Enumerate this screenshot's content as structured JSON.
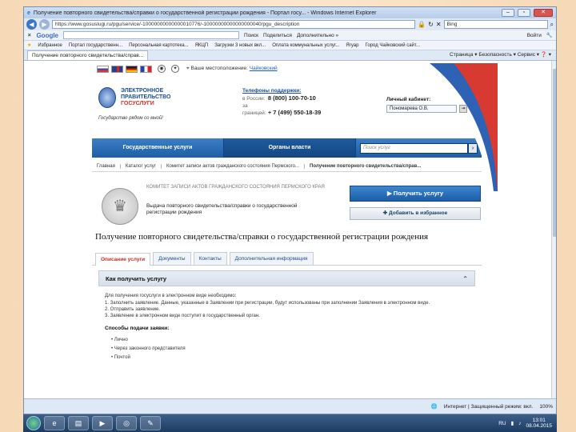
{
  "browser": {
    "title": "Получение повторного свидетельства/справки о государственной регистрации рождения - Портал госу... - Windows Internet Explorer",
    "address": "https://www.gosuslugi.ru/pgu/service/-10000000000000010776/-10000000000000000040/pgu_description",
    "search_engine": "Bing",
    "google_label": "Google",
    "google_search": "Поиск",
    "google_share": "Поделиться",
    "google_more": "Дополнительно »",
    "google_login": "Войти",
    "favorites_label": "Избранное",
    "favorites": [
      "Портал государственн...",
      "Персональная картотека...",
      "ЯКЦП",
      "Загрузки 3 новых вкл...",
      "Оплата коммунальных услуг...",
      "Ягуар",
      "Город Чайковский сайт..."
    ],
    "tab_label": "Получение повторного свидетельства/справ...",
    "tools": "Страница ▾  Безопасность ▾  Сервис ▾  ❓ ▾",
    "status_zone": "Интернет | Защищенный режим: вкл.",
    "zoom": "100%"
  },
  "site": {
    "brand_lines": [
      "ЭЛЕКТРОННОЕ",
      "ПРАВИТЕЛЬСТВО"
    ],
    "brand_sub": "ГОСУСЛУГИ",
    "slogan": "Государство рядом со мной!",
    "location_label": "Ваше местоположение:",
    "location_value": "Чайковский",
    "phones_title": "Телефоны поддержки:",
    "phone_label_1": "в России:",
    "phone_1": "8 (800) 100-70-10",
    "phone_label_2": "за границей:",
    "phone_2": "+ 7 (499) 550-18-39",
    "cabinet_label": "Личный кабинет:",
    "cabinet_user": "Пономарева О.В.",
    "nav": [
      "Государственные услуги",
      "Органы власти"
    ],
    "search_placeholder": "Поиск услуг",
    "breadcrumbs": [
      "Главная",
      "Каталог услуг",
      "Комитет записи актов гражданского состояния Пермского...",
      "Получение повторного свидетельства/справ..."
    ]
  },
  "service": {
    "org": "Комитет записи актов гражданского состояния Пермского края",
    "short_desc": "Выдача повторного свидетельства/справки о государственной регистрации рождения",
    "get_button": "Получить услугу",
    "fav_button": "Добавить в избранное",
    "title": "Получение повторного свидетельства/справки о государственной регистрации рождения",
    "tabs": [
      "Описание услуги",
      "Документы",
      "Контакты",
      "Дополнительная информация"
    ],
    "how_title": "Как получить услугу",
    "how_intro": "Для получения госуслуги в электронном виде необходимо:",
    "how_steps": [
      "1. Заполнить заявление. Данные, указанные в Заявлении при регистрации, будут использованы при заполнении Заявления в электронном виде.",
      "2. Отправить заявление.",
      "3. Заявление в электронном виде поступит в государственный орган."
    ],
    "methods_title": "Способы подачи заявки:",
    "methods": [
      "Лично",
      "Через законного представителя",
      "Почтой"
    ]
  },
  "taskbar": {
    "lang": "RU",
    "time": "13:01",
    "date": "08.04.2015"
  }
}
